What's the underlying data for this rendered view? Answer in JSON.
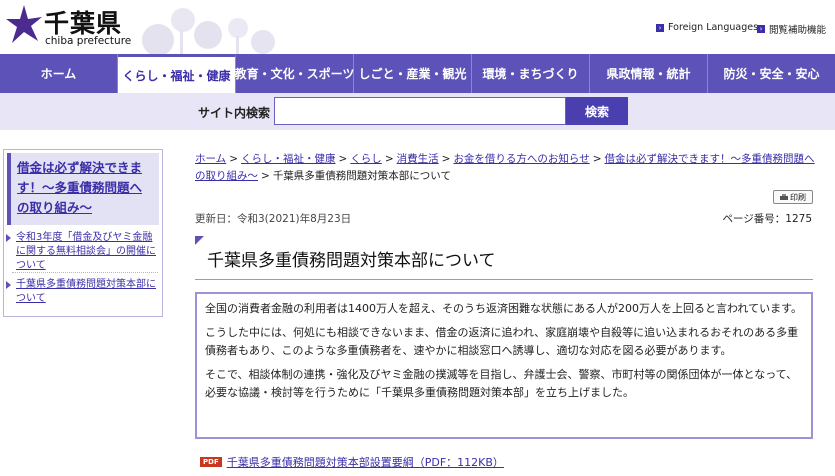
{
  "header": {
    "logo_title": "千葉県",
    "logo_sub": "chiba prefecture",
    "utility": {
      "foreign_languages": "Foreign Languages",
      "accessibility_tools": "閲覧補助機能"
    }
  },
  "gnav": {
    "items": [
      {
        "label": "ホーム",
        "active": false
      },
      {
        "label": "くらし・福祉・健康",
        "active": true
      },
      {
        "label": "教育・文化・スポーツ",
        "active": false
      },
      {
        "label": "しごと・産業・観光",
        "active": false
      },
      {
        "label": "環境・まちづくり",
        "active": false
      },
      {
        "label": "県政情報・統計",
        "active": false
      },
      {
        "label": "防災・安全・安心",
        "active": false
      }
    ]
  },
  "search": {
    "label": "サイト内検索",
    "placeholder": "",
    "button": "検索"
  },
  "sidebar": {
    "heading": "借金は必ず解決できます！～多重債務問題への取り組み～",
    "items": [
      {
        "label": "令和3年度「借金及びヤミ金融に関する無料相談会」の開催について"
      },
      {
        "label": "千葉県多重債務問題対策本部について"
      }
    ]
  },
  "breadcrumb": {
    "items": [
      "ホーム",
      "くらし・福祉・健康",
      "くらし",
      "消費生活",
      "お金を借りる方へのお知らせ",
      "借金は必ず解決できます！～多重債務問題への取り組み～"
    ],
    "current": "千葉県多重債務問題対策本部について",
    "separator": ">"
  },
  "page": {
    "print_label": "印刷",
    "updated": "更新日：令和3(2021)年8月23日",
    "page_number": "ページ番号：1275",
    "title": "千葉県多重債務問題対策本部について",
    "paragraphs": [
      "全国の消費者金融の利用者は1400万人を超え、そのうち返済困難な状態にある人が200万人を上回ると言われています。",
      "こうした中には、何処にも相談できないまま、借金の返済に追われ、家庭崩壊や自殺等に追い込まれるおそれのある多重債務者もあり、このような多重債務者を、速やかに相談窓口へ誘導し、適切な対応を図る必要があります。",
      "そこで、相談体制の連携・強化及びヤミ金融の撲滅等を目指し、弁護士会、警察、市町村等の関係団体が一体となって、必要な協議・検討等を行うために「千葉県多重債務問題対策本部」を立ち上げました。"
    ],
    "pdf_badge": "PDF",
    "pdf_link": "千葉県多重債務問題対策本部設置要綱（PDF：112KB）"
  },
  "colors": {
    "nav_bg": "#5d52b7",
    "link": "#3a2fa8",
    "search_bg": "#e8e6f6",
    "pdf_badge": "#c8371e"
  }
}
